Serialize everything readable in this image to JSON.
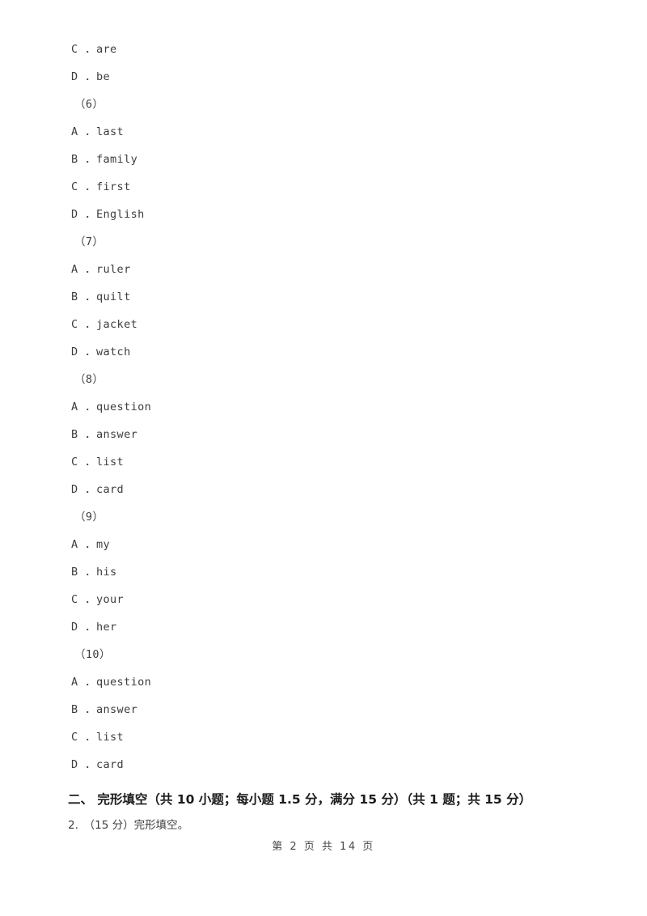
{
  "document": {
    "page_label": "第 2 页 共 14 页",
    "page_number": "2",
    "total_pages": "14",
    "text_color": "#3d3d3d",
    "heading_color": "#1c1c1c",
    "background_color": "#ffffff"
  },
  "body_lines": [
    {
      "id": "opt-5-c",
      "kind": "option",
      "text": "C ．are"
    },
    {
      "id": "opt-5-d",
      "kind": "option",
      "text": "D ．be"
    },
    {
      "id": "q-6",
      "kind": "question",
      "text": "（6）"
    },
    {
      "id": "opt-6-a",
      "kind": "option",
      "text": "A ．last"
    },
    {
      "id": "opt-6-b",
      "kind": "option",
      "text": "B ．family"
    },
    {
      "id": "opt-6-c",
      "kind": "option",
      "text": "C ．first"
    },
    {
      "id": "opt-6-d",
      "kind": "option",
      "text": "D ．English"
    },
    {
      "id": "q-7",
      "kind": "question",
      "text": "（7）"
    },
    {
      "id": "opt-7-a",
      "kind": "option",
      "text": "A ．ruler"
    },
    {
      "id": "opt-7-b",
      "kind": "option",
      "text": "B ．quilt"
    },
    {
      "id": "opt-7-c",
      "kind": "option",
      "text": "C ．jacket"
    },
    {
      "id": "opt-7-d",
      "kind": "option",
      "text": "D ．watch"
    },
    {
      "id": "q-8",
      "kind": "question",
      "text": "（8）"
    },
    {
      "id": "opt-8-a",
      "kind": "option",
      "text": "A ．question"
    },
    {
      "id": "opt-8-b",
      "kind": "option",
      "text": "B ．answer"
    },
    {
      "id": "opt-8-c",
      "kind": "option",
      "text": "C ．list"
    },
    {
      "id": "opt-8-d",
      "kind": "option",
      "text": "D ．card"
    },
    {
      "id": "q-9",
      "kind": "question",
      "text": "（9）"
    },
    {
      "id": "opt-9-a",
      "kind": "option",
      "text": "A ．my"
    },
    {
      "id": "opt-9-b",
      "kind": "option",
      "text": "B ．his"
    },
    {
      "id": "opt-9-c",
      "kind": "option",
      "text": "C ．your"
    },
    {
      "id": "opt-9-d",
      "kind": "option",
      "text": "D ．her"
    },
    {
      "id": "q-10",
      "kind": "question",
      "text": "（10）"
    },
    {
      "id": "opt-10-a",
      "kind": "option",
      "text": "A ．question"
    },
    {
      "id": "opt-10-b",
      "kind": "option",
      "text": "B ．answer"
    },
    {
      "id": "opt-10-c",
      "kind": "option",
      "text": "C ．list"
    },
    {
      "id": "opt-10-d",
      "kind": "option",
      "text": "D ．card"
    }
  ],
  "section": {
    "heading": "二、 完形填空（共 10 小题；每小题 1.5 分，满分 15 分）（共 1 题；共 15 分）",
    "number": "二、",
    "title": "完形填空",
    "detail": "（共 10 小题；每小题 1.5 分，满分 15 分）",
    "total": "（共 1 题；共 15 分）"
  },
  "sub_item": {
    "text": "2.　（15 分）完形填空。",
    "number": "2.",
    "points": "（15 分）",
    "label": "完形填空。"
  }
}
